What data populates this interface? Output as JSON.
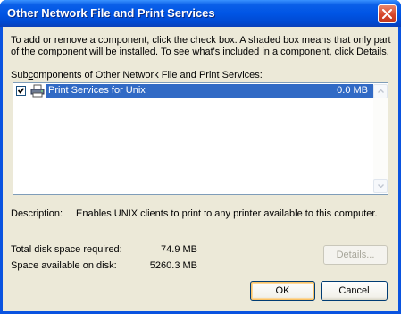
{
  "window": {
    "title": "Other Network File and Print Services"
  },
  "instructions": {
    "line1": "To add or remove a component, click the check box. A shaded box means that only part",
    "line2": "of the component will be installed. To see what's included in a component, click Details."
  },
  "subcomponents": {
    "label_prefix": "Sub",
    "label_accel": "c",
    "label_rest": "omponents of Other Network File and Print Services:",
    "items": [
      {
        "label": "Print Services for Unix",
        "size": "0.0 MB",
        "checked": true,
        "icon": "printer-icon"
      }
    ]
  },
  "description": {
    "label": "Description:",
    "text": "Enables UNIX clients to print to any printer available to this computer."
  },
  "disk": {
    "required_label": "Total disk space required:",
    "required_value": "74.9 MB",
    "available_label": "Space available on disk:",
    "available_value": "5260.3 MB"
  },
  "buttons": {
    "details_accel": "D",
    "details_rest": "etails...",
    "ok": "OK",
    "cancel": "Cancel"
  },
  "colors": {
    "titlebar": "#0055e5",
    "selection": "#316ac5",
    "dialog_bg": "#ece9d8",
    "close": "#d6462a"
  }
}
